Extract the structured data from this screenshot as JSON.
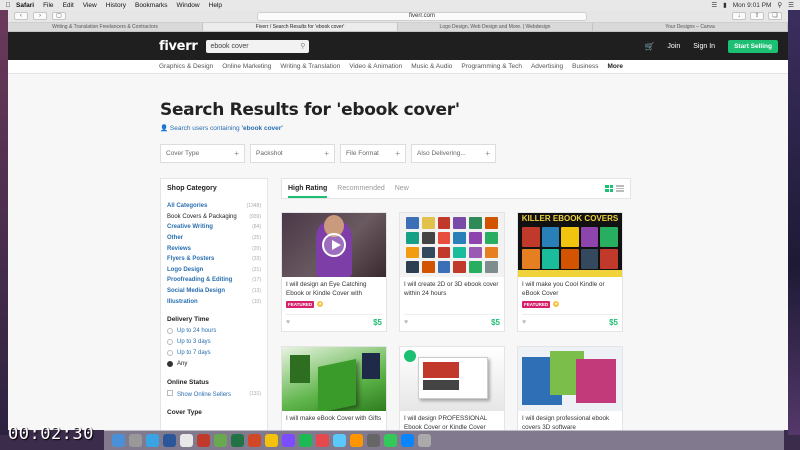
{
  "menubar": {
    "app": "Safari",
    "items": [
      "File",
      "Edit",
      "View",
      "History",
      "Bookmarks",
      "Window",
      "Help"
    ],
    "clock": "Mon 9:01 PM"
  },
  "browser": {
    "url": "fiverr.com",
    "tabs": [
      "Writing & Translation Freelancers & Contractors",
      "Fiverr / Search Results for 'ebook cover'",
      "Logo Design, Web Design and More. | Webdesign",
      "Your Designs – Canva"
    ]
  },
  "header": {
    "logo": "fiverr",
    "search_value": "ebook cover",
    "join": "Join",
    "signin": "Sign In",
    "start_selling": "Start Selling"
  },
  "categories": [
    "Graphics & Design",
    "Online Marketing",
    "Writing & Translation",
    "Video & Animation",
    "Music & Audio",
    "Programming & Tech",
    "Advertising",
    "Business",
    "More"
  ],
  "page": {
    "title": "Search Results for 'ebook cover'",
    "users_prefix": "Search users containing",
    "users_term": "'ebook cover'"
  },
  "filters": [
    "Cover Type",
    "Packshot",
    "File Format",
    "Also Delivering..."
  ],
  "sidebar": {
    "heading": "Shop Category",
    "items": [
      {
        "label": "All Categories",
        "count": "(1348)"
      },
      {
        "label": "Book Covers & Packaging",
        "count": "(939)"
      },
      {
        "label": "Creative Writing",
        "count": "(84)"
      },
      {
        "label": "Other",
        "count": "(25)"
      },
      {
        "label": "Reviews",
        "count": "(20)"
      },
      {
        "label": "Flyers & Posters",
        "count": "(33)"
      },
      {
        "label": "Logo Design",
        "count": "(21)"
      },
      {
        "label": "Proofreading & Editing",
        "count": "(17)"
      },
      {
        "label": "Social Media Design",
        "count": "(13)"
      },
      {
        "label": "Illustration",
        "count": "(10)"
      }
    ],
    "delivery_heading": "Delivery Time",
    "delivery": [
      "Up to 24 hours",
      "Up to 3 days",
      "Up to 7 days",
      "Any"
    ],
    "online_heading": "Online Status",
    "online_label": "Show Online Sellers",
    "online_count": "(131)",
    "cover_heading": "Cover Type"
  },
  "results": {
    "tabs": [
      "High Rating",
      "Recommended",
      "New"
    ],
    "cards": [
      {
        "title": "I will design an Eye Catching Ebook or Kindle Cover with",
        "price": "$5",
        "featured": "FEATURED"
      },
      {
        "title": "I will create 2D or 3D ebook cover within 24 hours",
        "price": "$5"
      },
      {
        "title": "I will make you Cool Kindle or eBook Cover",
        "price": "$5",
        "featured": "FEATURED",
        "thumb_text": "KILLER EBOOK COVERS"
      },
      {
        "title": "I will make eBook Cover with Gifts"
      },
      {
        "title": "I will design PROFESSIONAL Ebook Cover or Kindle Cover"
      },
      {
        "title": "I will design professional ebook covers 3D software"
      }
    ]
  },
  "overlay": {
    "timer": "00:02:30"
  },
  "colors": {
    "brand": "#1dbf73",
    "header": "#1f1f1f",
    "featured": "#d5216c",
    "link": "#2a6fb0"
  }
}
